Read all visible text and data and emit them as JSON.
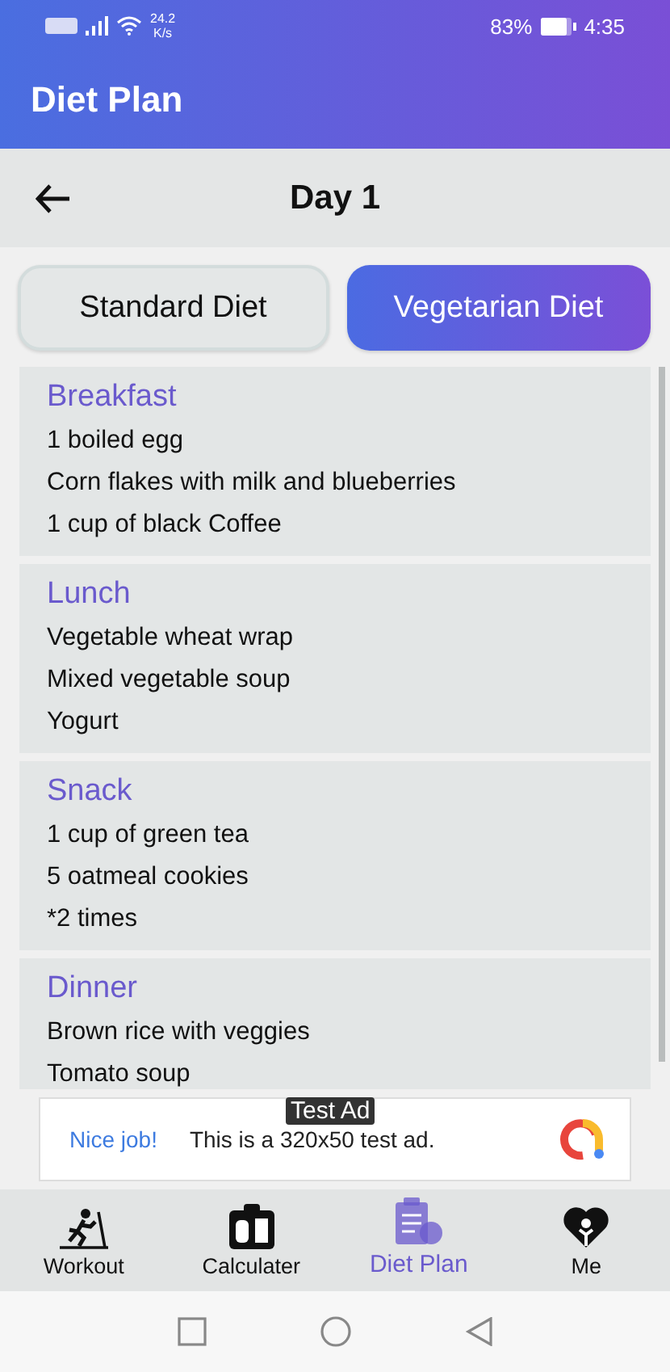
{
  "status_bar": {
    "speed": "24.2",
    "speed_unit": "K/s",
    "battery": "83%",
    "time": "4:35"
  },
  "app_bar": {
    "title": "Diet Plan"
  },
  "header": {
    "title": "Day 1"
  },
  "tabs": [
    {
      "label": "Standard Diet",
      "selected": false
    },
    {
      "label": "Vegetarian Diet",
      "selected": true
    }
  ],
  "meals": [
    {
      "title": "Breakfast",
      "items": [
        "1 boiled egg",
        "Corn flakes with milk and blueberries",
        "1 cup of black Coffee"
      ]
    },
    {
      "title": "Lunch",
      "items": [
        "Vegetable wheat wrap",
        "Mixed vegetable soup",
        "Yogurt"
      ]
    },
    {
      "title": "Snack",
      "items": [
        "1 cup of green tea",
        "5 oatmeal cookies",
        "*2 times"
      ]
    },
    {
      "title": "Dinner",
      "items": [
        "Brown rice with veggies",
        "Tomato soup"
      ]
    }
  ],
  "ad": {
    "badge": "Test Ad",
    "headline": "Nice job!",
    "text": "This is a 320x50 test ad."
  },
  "bottom_nav": [
    {
      "label": "Workout",
      "selected": false
    },
    {
      "label": "Calculater",
      "selected": false
    },
    {
      "label": "Diet Plan",
      "selected": true
    },
    {
      "label": "Me",
      "selected": false
    }
  ]
}
